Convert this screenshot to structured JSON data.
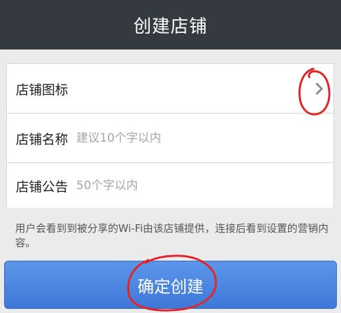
{
  "header": {
    "title": "创建店铺"
  },
  "form": {
    "rows": [
      {
        "label": "店铺图标",
        "has_chevron": true
      },
      {
        "label": "店铺名称",
        "placeholder": "建议10个字以内",
        "value": ""
      },
      {
        "label": "店铺公告",
        "placeholder": "50个字以内",
        "value": ""
      }
    ]
  },
  "hint": "用户会看到到被分享的Wi-Fi由该店铺提供，连接后看到设置的营销内容。",
  "submit": {
    "label": "确定创建"
  },
  "colors": {
    "header_bg": "#343a40",
    "page_bg": "#ebebeb",
    "button_accent": "#4a86e1",
    "annotation_red": "#e1262b"
  },
  "annotations": [
    {
      "target": "icon-row-chevron",
      "shape": "circle",
      "color": "red"
    },
    {
      "target": "submit-button",
      "shape": "circle",
      "color": "red"
    }
  ]
}
